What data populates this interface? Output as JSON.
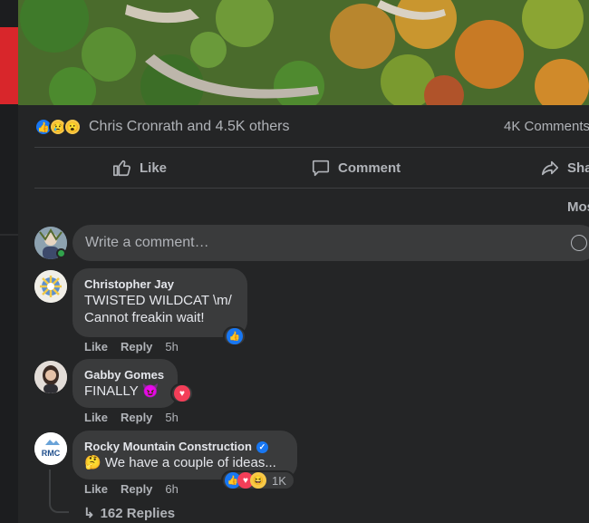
{
  "post": {
    "reactions_summary": "Chris Cronrath and 4.5K others",
    "comments_count": "4K Comments",
    "reaction_icons": [
      "like-icon",
      "sad-icon",
      "wow-icon"
    ]
  },
  "actions": {
    "like": "Like",
    "comment": "Comment",
    "share": "Share"
  },
  "sort": {
    "label": "Most relevant"
  },
  "composer": {
    "placeholder": "Write a comment…"
  },
  "comments": [
    {
      "name": "Christopher Jay",
      "lines": [
        "TWISTED WILDCAT \\m/",
        "Cannot freakin wait!"
      ],
      "like": "Like",
      "reply": "Reply",
      "time": "5h",
      "reactions": [
        "like"
      ]
    },
    {
      "name": "Gabby Gomes",
      "lines": [
        "FINALLY 😈"
      ],
      "like": "Like",
      "reply": "Reply",
      "time": "5h",
      "reactions": [
        "love"
      ]
    },
    {
      "name": "Rocky Mountain Construction",
      "verified": true,
      "avatar_text": "RMC",
      "lines": [
        "🤔 We have a couple of ideas..."
      ],
      "like": "Like",
      "reply": "Reply",
      "time": "6h",
      "reactions": [
        "like",
        "love",
        "haha"
      ],
      "reaction_count": "1K",
      "replies": "162 Replies"
    }
  ],
  "colors": {
    "background": "#18191a",
    "card": "#242526",
    "bubble": "#3a3b3c",
    "accent": "#1877f2",
    "love": "#f33e58"
  }
}
